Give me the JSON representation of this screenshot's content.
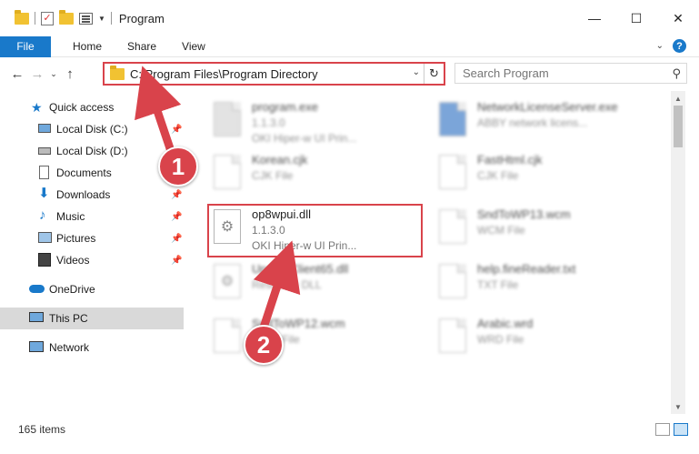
{
  "window": {
    "title": "Program",
    "minimize": "—",
    "maximize": "☐",
    "close": "✕"
  },
  "ribbon": {
    "file_tab": "File",
    "tabs": [
      "Home",
      "Share",
      "View"
    ],
    "help": "?"
  },
  "address": {
    "path": "C:\\Program Files\\Program Directory",
    "search_placeholder": "Search Program"
  },
  "sidebar": {
    "items": [
      {
        "label": "Quick access",
        "icon": "star-icon"
      },
      {
        "label": "Local Disk (C:)",
        "icon": "drive-icon"
      },
      {
        "label": "Local Disk (D:)",
        "icon": "drive-icon"
      },
      {
        "label": "Documents",
        "icon": "documents-icon"
      },
      {
        "label": "Downloads",
        "icon": "download-icon"
      },
      {
        "label": "Music",
        "icon": "music-icon"
      },
      {
        "label": "Pictures",
        "icon": "pictures-icon"
      },
      {
        "label": "Videos",
        "icon": "videos-icon"
      },
      {
        "label": "OneDrive",
        "icon": "cloud-icon"
      },
      {
        "label": "This PC",
        "icon": "computer-icon"
      },
      {
        "label": "Network",
        "icon": "network-icon"
      }
    ]
  },
  "files": [
    {
      "name": "program.exe",
      "line1": "1.1.3.0",
      "line2": "OKI Hiper-w UI Prin..."
    },
    {
      "name": "NetworkLicenseServer.exe",
      "line1": "ABBY network licens...",
      "line2": ""
    },
    {
      "name": "Korean.cjk",
      "line1": "CJK File",
      "line2": ""
    },
    {
      "name": "FastHtml.cjk",
      "line1": "CJK File",
      "line2": ""
    },
    {
      "name": "op8wpui.dll",
      "line1": "1.1.3.0",
      "line2": "OKI Hiper-w UI Prin..."
    },
    {
      "name": "SndToWP13.wcm",
      "line1": "WCM File",
      "line2": ""
    },
    {
      "name": "UpdateClient65.dll",
      "line1": "Resource DLL",
      "line2": ""
    },
    {
      "name": "help.fineReader.txt",
      "line1": "TXT File",
      "line2": ""
    },
    {
      "name": "SndToWP12.wcm",
      "line1": "WCM File",
      "line2": ""
    },
    {
      "name": "Arabic.wrd",
      "line1": "WRD File",
      "line2": ""
    }
  ],
  "status": {
    "item_count": "165 items"
  },
  "annotations": {
    "badge1": "1",
    "badge2": "2",
    "color": "#d9434b"
  }
}
